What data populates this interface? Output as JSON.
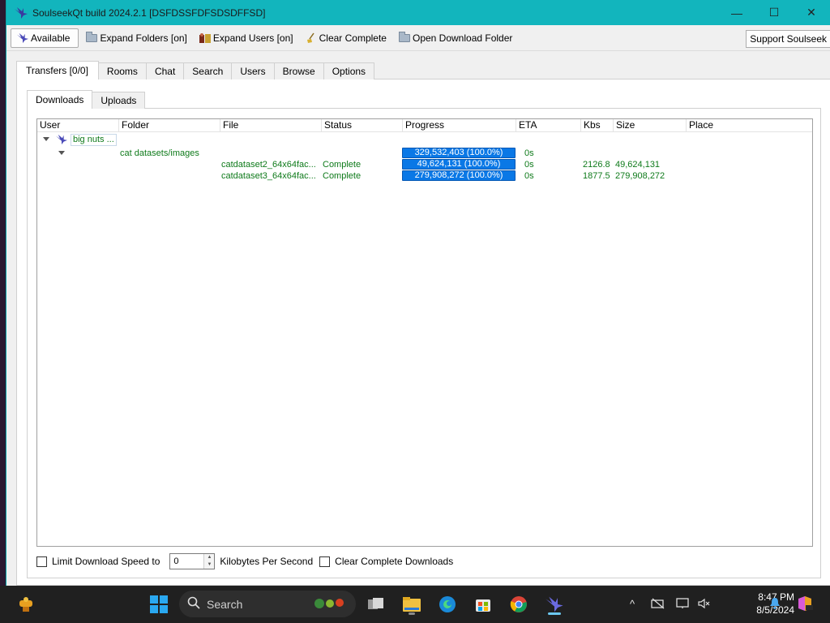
{
  "window": {
    "title": "SoulseekQt build 2024.2.1 [DSFDSSFDFSDSDFFSD]",
    "controls": {
      "minimize": "—",
      "maximize": "☐",
      "close": "✕"
    }
  },
  "toolbar": {
    "available": "Available",
    "expand_folders": "Expand Folders [on]",
    "expand_users": "Expand Users [on]",
    "clear_complete": "Clear Complete",
    "open_download_folder": "Open Download Folder",
    "support": "Support Soulseek"
  },
  "tabs": [
    {
      "label": "Transfers [0/0]",
      "active": true
    },
    {
      "label": "Rooms"
    },
    {
      "label": "Chat"
    },
    {
      "label": "Search"
    },
    {
      "label": "Users"
    },
    {
      "label": "Browse"
    },
    {
      "label": "Options"
    }
  ],
  "subtabs": [
    {
      "label": "Downloads",
      "active": true
    },
    {
      "label": "Uploads"
    }
  ],
  "columns": [
    "User",
    "Folder",
    "File",
    "Status",
    "Progress",
    "ETA",
    "Kbs",
    "Size",
    "Place"
  ],
  "downloads": {
    "user": "big nuts ...",
    "folder": "cat datasets/images",
    "folder_progress": "329,532,403 (100.0%)",
    "folder_eta": "0s",
    "files": [
      {
        "file": "catdataset2_64x64fac...",
        "status": "Complete",
        "progress": "49,624,131 (100.0%)",
        "progress_fraction": 1.0,
        "eta": "0s",
        "kbs": "2126.8",
        "size": "49,624,131"
      },
      {
        "file": "catdataset3_64x64fac...",
        "status": "Complete",
        "progress": "279,908,272 (100.0%)",
        "progress_fraction": 1.0,
        "eta": "0s",
        "kbs": "1877.5",
        "size": "279,908,272"
      }
    ]
  },
  "footer": {
    "limit_speed_label": "Limit Download Speed to",
    "speed_value": "0",
    "units_label": "Kilobytes Per Second",
    "clear_complete_label": "Clear Complete Downloads"
  },
  "taskbar": {
    "search_placeholder": "Search",
    "time": "8:47 PM",
    "date": "8/5/2024"
  },
  "colors": {
    "titlebar": "#12b5bd",
    "progress": "#0a78e6",
    "row_text": "#0e7a1a"
  }
}
